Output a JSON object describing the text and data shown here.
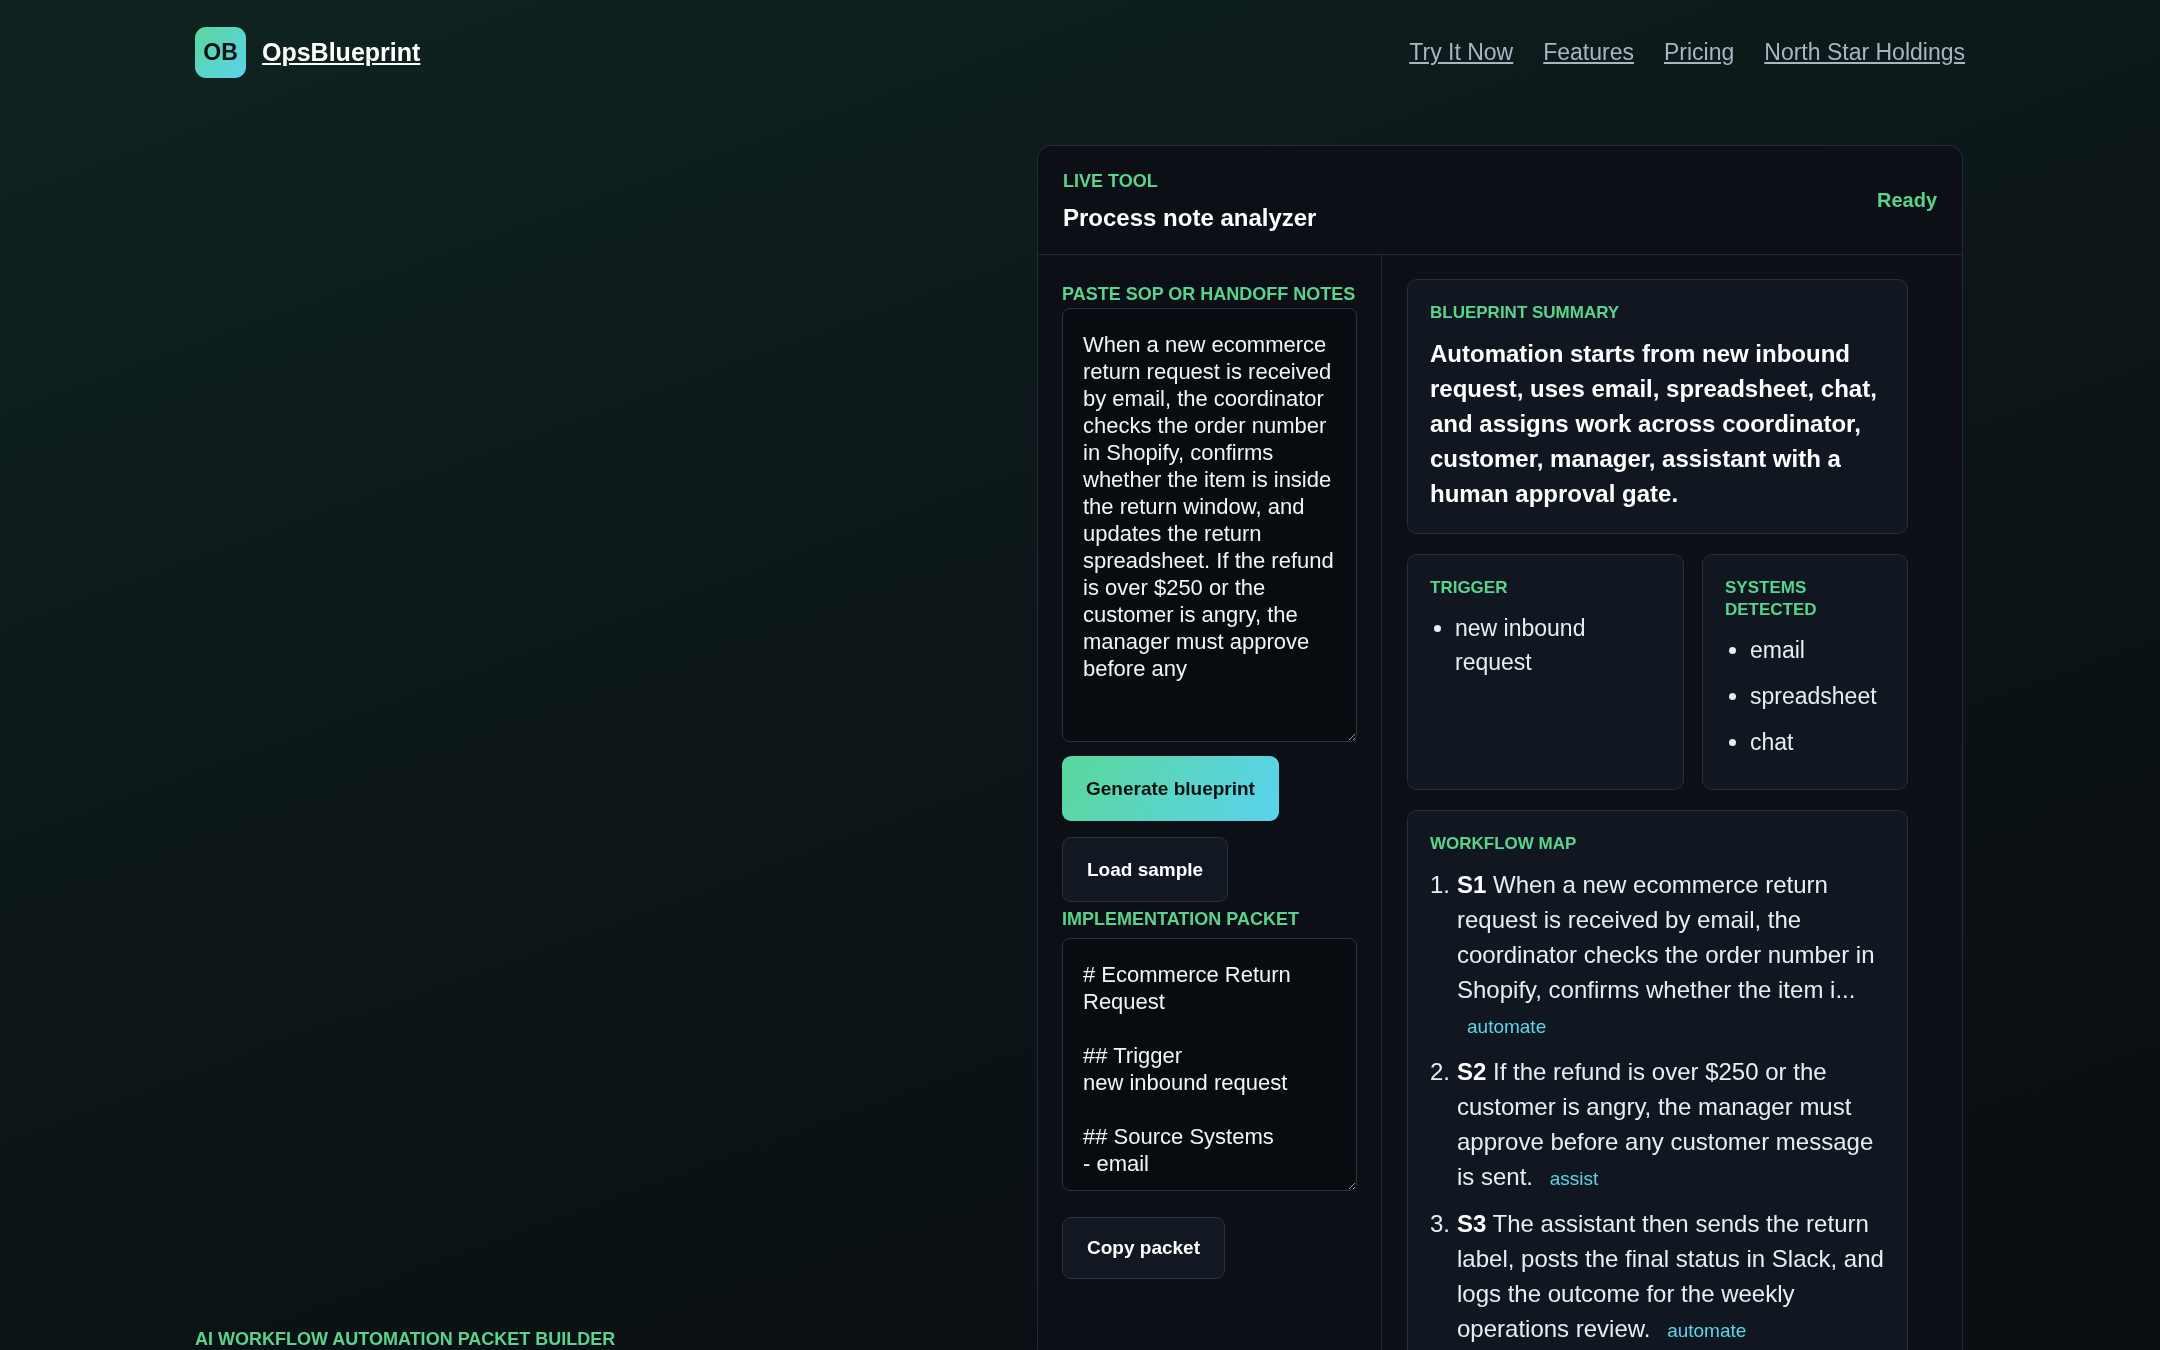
{
  "header": {
    "logo_mark": "OB",
    "brand": "OpsBlueprint",
    "nav": [
      "Try It Now",
      "Features",
      "Pricing",
      "North Star Holdings"
    ]
  },
  "hero": {
    "eyebrow": "AI WORKFLOW AUTOMATION PACKET BUILDER"
  },
  "tool": {
    "eyebrow": "LIVE TOOL",
    "title": "Process note analyzer",
    "status": "Ready",
    "notes_label": "PASTE SOP OR HANDOFF NOTES",
    "notes_value": "When a new ecommerce return request is received by email, the coordinator checks the order number in Shopify, confirms whether the item is inside the return window, and updates the return spreadsheet. If the refund is over $250 or the customer is angry, the manager must approve before any",
    "buttons": [
      {
        "label": "Generate blueprint",
        "kind": "primary"
      },
      {
        "label": "Load sample",
        "kind": "secondary"
      }
    ],
    "packet_label": "IMPLEMENTATION PACKET",
    "packet_value": "# Ecommerce Return Request\n\n## Trigger\nnew inbound request\n\n## Source Systems\n- email",
    "copy_button": "Copy packet",
    "summary": {
      "label": "BLUEPRINT SUMMARY",
      "text": "Automation starts from new inbound request, uses email, spreadsheet, chat, and assigns work across coordinator, customer, manager, assistant with a human approval gate."
    },
    "trigger": {
      "label": "TRIGGER",
      "items": [
        "new inbound request"
      ]
    },
    "systems": {
      "label": "SYSTEMS DETECTED",
      "items": [
        "email",
        "spreadsheet",
        "chat"
      ]
    },
    "workflow": {
      "label": "WORKFLOW MAP",
      "steps": [
        {
          "number": "1.",
          "id": "S1",
          "text": "When a new ecommerce return request is received by email, the coordinator checks the order number in Shopify, confirms whether the item i...",
          "mode": "automate"
        },
        {
          "number": "2.",
          "id": "S2",
          "text": "If the refund is over $250 or the customer is angry, the manager must approve before any customer message is sent.",
          "mode": "assist"
        },
        {
          "number": "3.",
          "id": "S3",
          "text": "The assistant then sends the return label, posts the final status in Slack, and logs the outcome for the weekly operations review.",
          "mode": "automate"
        }
      ]
    }
  }
}
